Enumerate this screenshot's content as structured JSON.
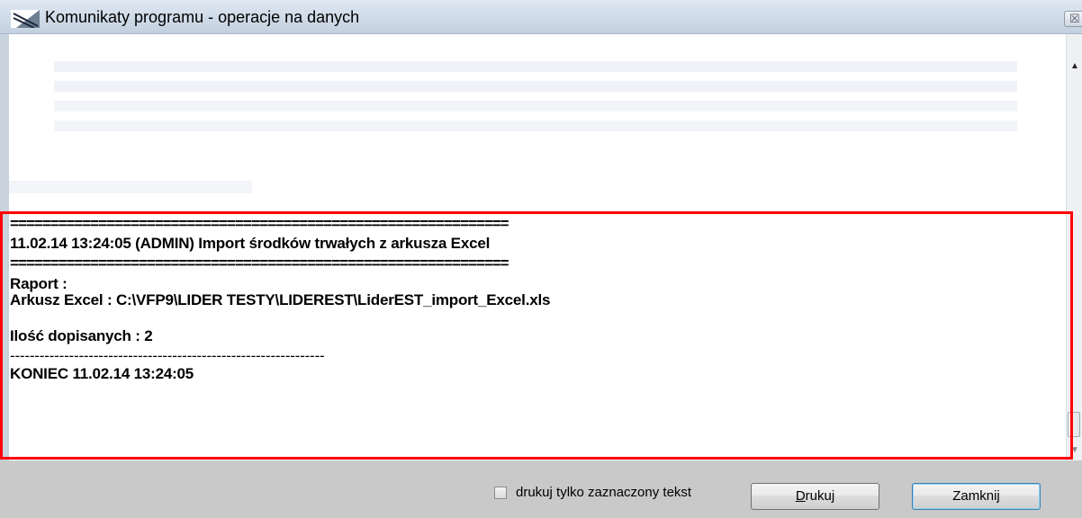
{
  "window": {
    "title": "Komunikaty programu - operacje na danych",
    "close_glyph": "☒"
  },
  "log": {
    "separator": "==============================================================",
    "header": "11.02.14 13:24:05 (ADMIN) Import środków trwałych z arkusza Excel",
    "report_label": "Raport :",
    "sheet_line": "Arkusz Excel : C:\\VFP9\\LIDER TESTY\\LIDEREST\\LiderEST_import_Excel.xls",
    "count_line": "Ilość dopisanych : 2",
    "dash_line": "----------------------------------------------------------------",
    "end_line": "KONIEC 11.02.14 13:24:05"
  },
  "footer": {
    "checkbox_label": "drukuj tylko zaznaczony tekst",
    "checkbox_checked": false,
    "print_button": {
      "underlined": "D",
      "rest": "rukuj"
    },
    "close_button": "Zamknij"
  },
  "colors": {
    "highlight": "#ff0000",
    "titlebar": "#c3d0df",
    "footer_bg": "#c9c9c9"
  }
}
